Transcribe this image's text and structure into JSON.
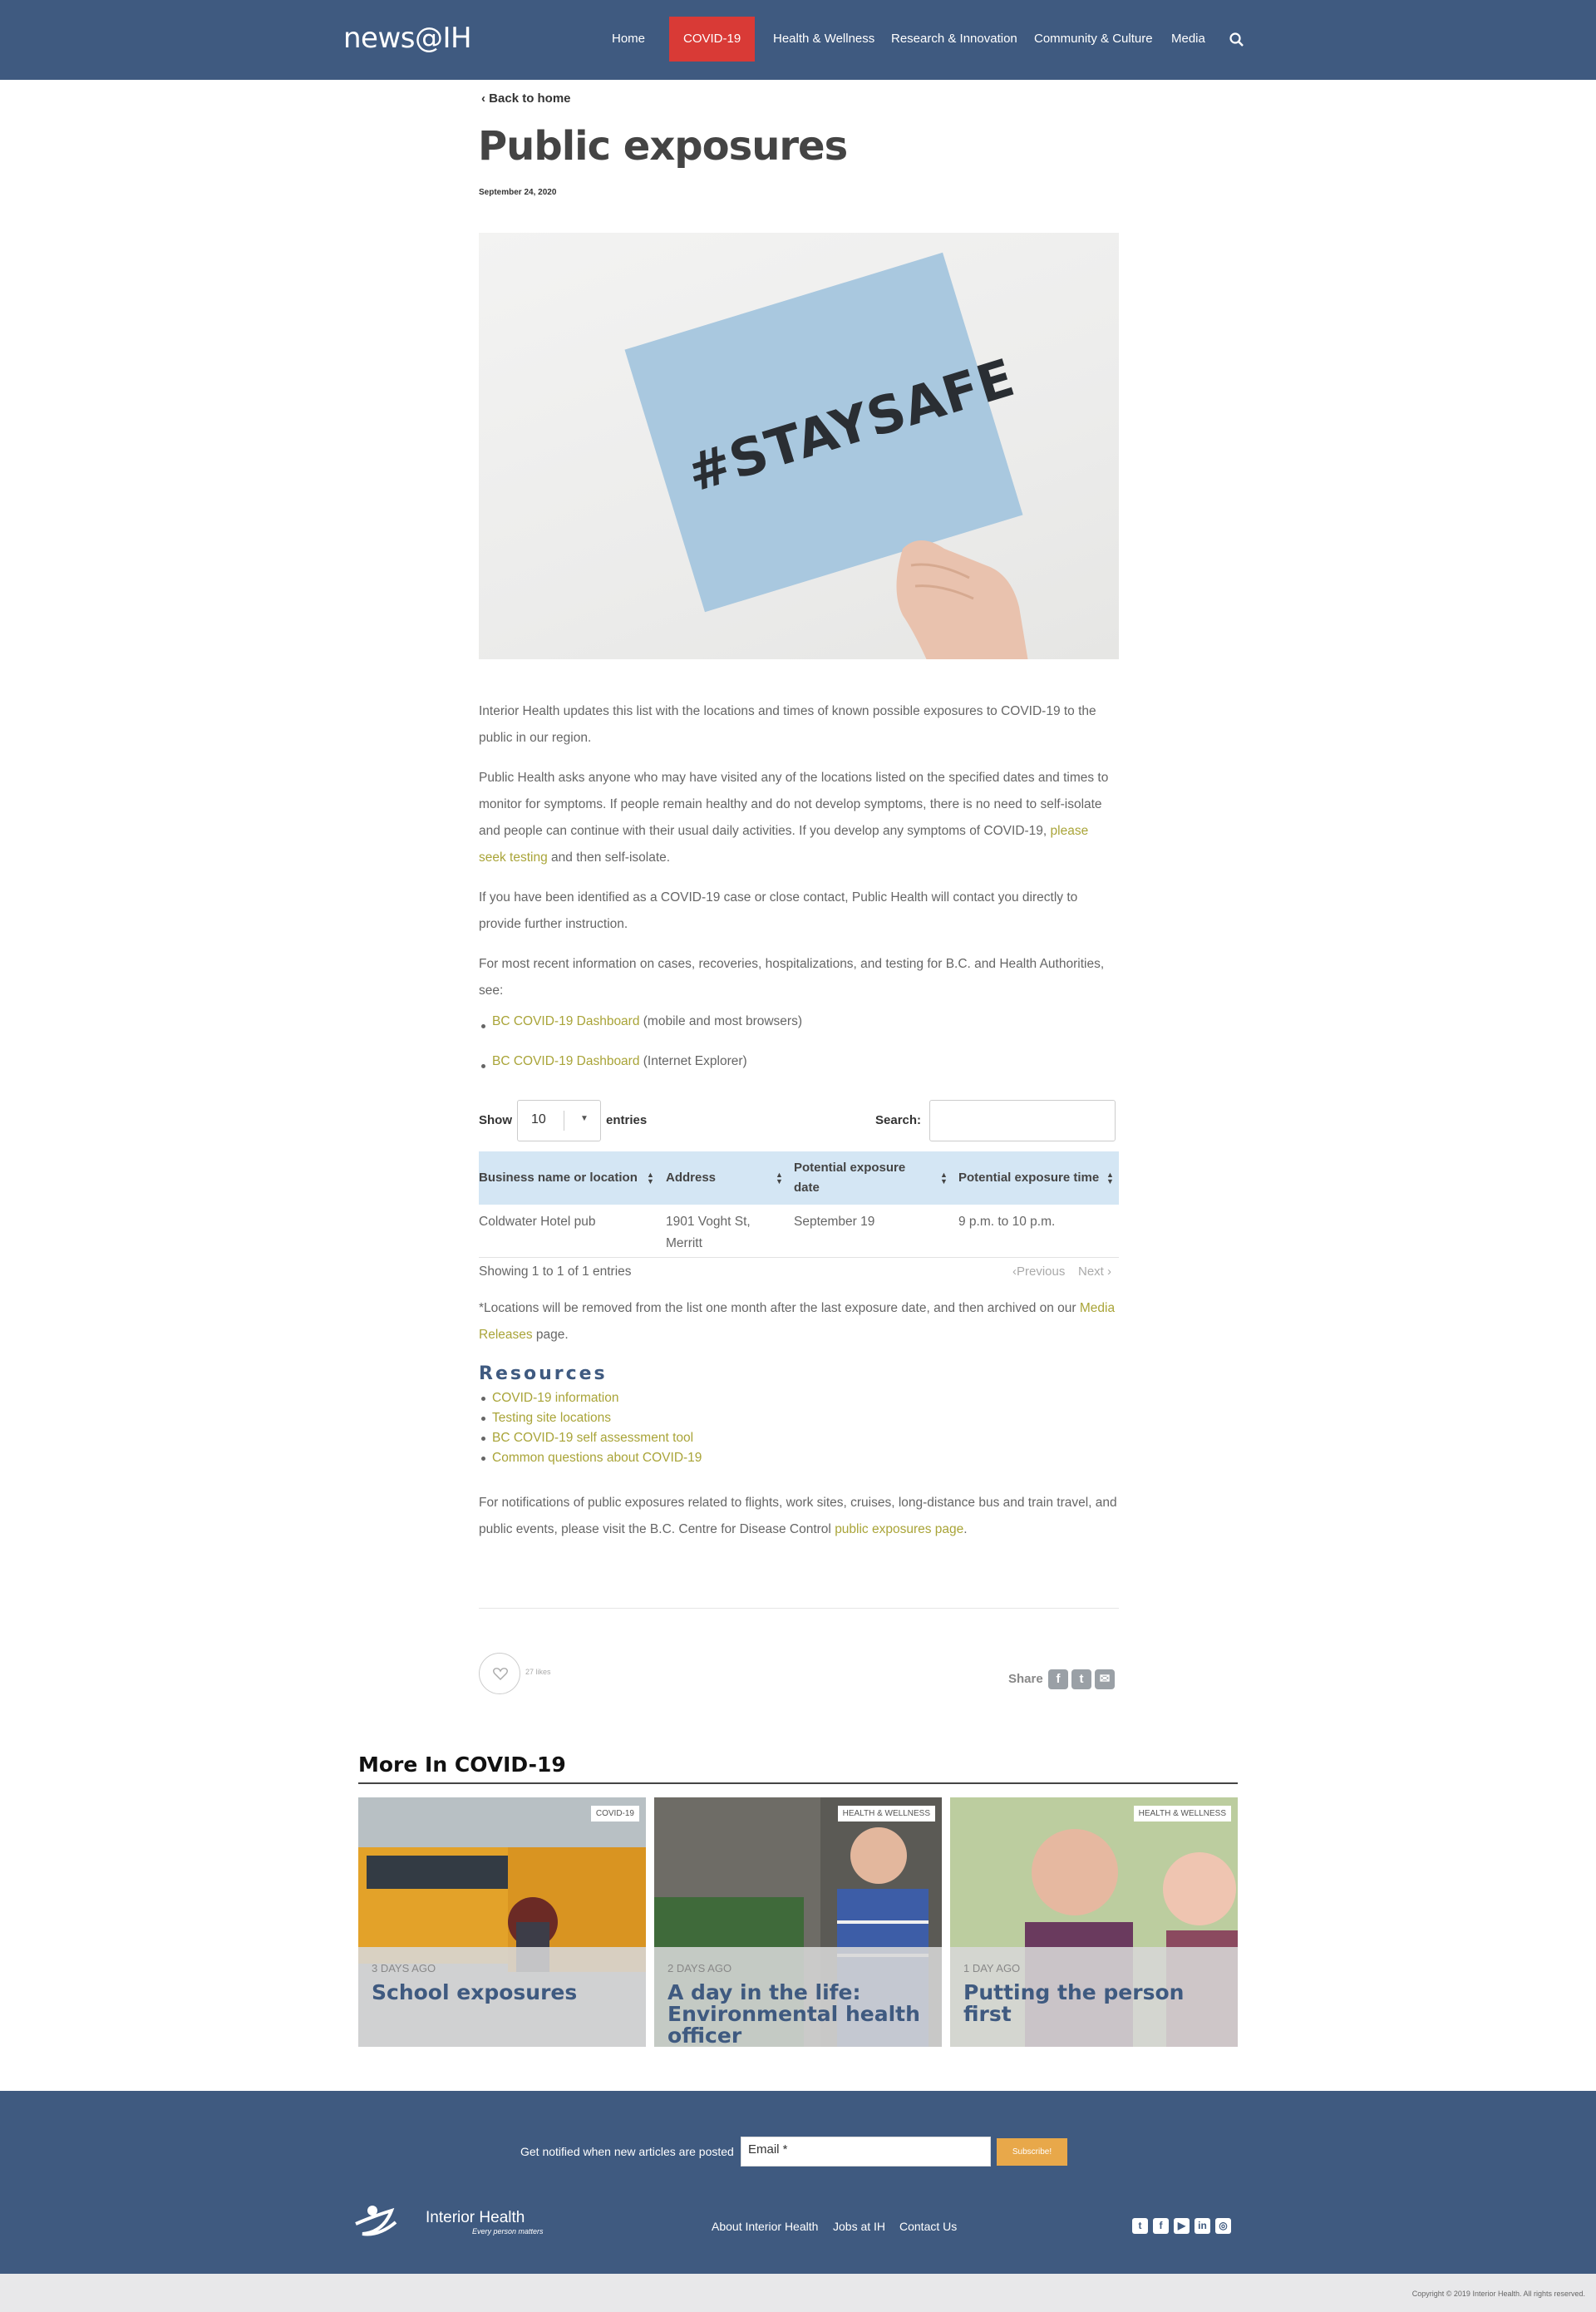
{
  "nav": {
    "logo": "news@IH",
    "items": [
      "Home",
      "COVID-19",
      "Health & Wellness",
      "Research & Innovation",
      "Community & Culture",
      "Media"
    ],
    "active": "COVID-19",
    "search_icon": "search-icon"
  },
  "article": {
    "back": "Back to home",
    "title": "Public exposures",
    "date": "September 24, 2020",
    "hero_text": "#STAYSAFE",
    "p1": "Interior Health updates this list with the locations and times of known possible exposures to COVID-19 to the public in our region.",
    "p2_a": "Public Health asks anyone who may have visited any of the locations listed on the specified dates and times to monitor for symptoms. If people remain healthy and do not develop symptoms, there is no need to self-isolate and people can continue with their usual daily activities. If you develop any symptoms of COVID-19, ",
    "p2_link": "please seek testing",
    "p2_b": " and then self-isolate.",
    "p3": "If you have been identified as a COVID-19 case or close contact, Public Health will contact you directly to provide further instruction.",
    "p4": "For most recent information on cases, recoveries, hospitalizations, and testing for B.C. and Health Authorities, see:",
    "bullets": [
      {
        "link": "BC COVID-19 Dashboard",
        "text": " (mobile and most browsers)"
      },
      {
        "link": "BC COVID-19 Dashboard",
        "text": " (Internet Explorer)"
      }
    ],
    "p5_a": "*Locations will be removed from the list one month after the last exposure date, and then archived on our ",
    "p5_link": "Media Releases",
    "p5_b": " page.",
    "p6_a": "For notifications of public exposures related to flights, work sites, cruises, long-distance bus and train travel, and public events, please visit the B.C. Centre for Disease Control ",
    "p6_link": "public exposures page",
    "p6_b": "."
  },
  "datatable": {
    "show": "Show",
    "length_value": "10",
    "entries": "entries",
    "search_label": "Search:",
    "columns": [
      "Business name or location",
      "Address",
      "Potential exposure date",
      "Potential exposure time"
    ],
    "rows": [
      [
        "Coldwater Hotel pub",
        "1901 Voght St, Merritt",
        "September 19",
        "9 p.m. to 10 p.m."
      ]
    ],
    "info": "Showing 1 to 1 of 1 entries",
    "previous": "Previous",
    "next": "Next"
  },
  "resources": {
    "title": "Resources",
    "items": [
      "COVID-19 information",
      "Testing site locations",
      "BC COVID-19 self assessment tool",
      "Common questions about COVID-19"
    ]
  },
  "engagement": {
    "likes": "27 likes",
    "share": "Share",
    "share_icons": [
      "facebook-icon",
      "twitter-icon",
      "email-icon"
    ]
  },
  "more": {
    "title": "More In COVID-19",
    "tiles": [
      {
        "category": "COVID-19",
        "ago": "3 DAYS AGO",
        "title": "School exposures"
      },
      {
        "category": "HEALTH & WELLNESS",
        "ago": "2 DAYS AGO",
        "title": "A day in the life: Environmental health officer"
      },
      {
        "category": "HEALTH & WELLNESS",
        "ago": "1 DAY AGO",
        "title": "Putting the person first"
      }
    ]
  },
  "footer": {
    "notify": "Get notified when new articles are posted",
    "email_placeholder": "Email *",
    "subscribe": "Subscribe!",
    "logo_text": "Interior Health",
    "logo_tagline": "Every person matters",
    "links": [
      "About Interior Health",
      "Jobs at IH",
      "Contact Us"
    ],
    "social": [
      "twitter-icon",
      "facebook-icon",
      "youtube-icon",
      "linkedin-icon",
      "instagram-icon"
    ],
    "copyright": "Copyright © 2019 Interior Health. All rights reserved."
  },
  "colors": {
    "brand_blue": "#3f5a80",
    "active_red": "#d93a36",
    "link_olive": "#a9a438",
    "table_head": "#d4e6f4",
    "subscribe": "#e8a84a"
  }
}
